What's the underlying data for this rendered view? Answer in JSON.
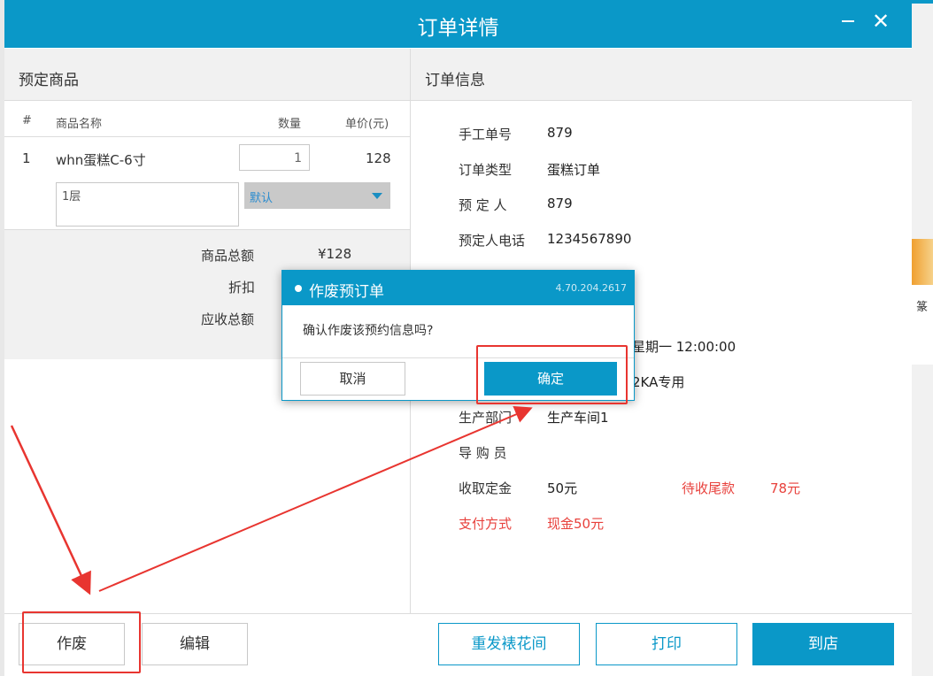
{
  "window": {
    "title": "订单详情"
  },
  "left_panel": {
    "header": "预定商品",
    "columns": {
      "no": "#",
      "name": "商品名称",
      "qty": "数量",
      "price": "单价(元)"
    },
    "items": [
      {
        "no": "1",
        "name": "whn蛋糕C-6寸",
        "qty": "1",
        "price": "128",
        "note": "1层",
        "option": "默认"
      }
    ],
    "summary": {
      "total_label": "商品总额",
      "total_value": "¥128",
      "discount_label": "折扣",
      "receivable_label": "应收总额"
    }
  },
  "right_panel": {
    "header": "订单信息",
    "fields": {
      "manual_no_label": "手工单号",
      "manual_no_value": "879",
      "type_label": "订单类型",
      "type_value": "蛋糕订单",
      "booker_label": "预 定 人",
      "booker_value": "879",
      "phone_label": "预定人电话",
      "phone_value": "1234567890",
      "date_partial": "星期一 12:00:00",
      "store_partial": "2KA专用",
      "dept_label": "生产部门",
      "dept_value": "生产车间1",
      "guide_label": "导 购 员",
      "deposit_label": "收取定金",
      "deposit_value": "50元",
      "balance_label": "待收尾款",
      "balance_value": "78元",
      "payment_label": "支付方式",
      "payment_value": "现金50元"
    }
  },
  "bottom_buttons": {
    "void": "作废",
    "edit": "编辑",
    "resend": "重发裱花间",
    "print": "打印",
    "arrive": "到店"
  },
  "modal": {
    "title": "作废预订单",
    "version": "4.70.204.2617",
    "message": "确认作废该预约信息吗?",
    "cancel": "取消",
    "confirm": "确定"
  },
  "background": {
    "side_glyph": "篆"
  },
  "colors": {
    "accent": "#0a98c8",
    "warning_red": "#e8413c",
    "annotation_red": "#e83530"
  }
}
